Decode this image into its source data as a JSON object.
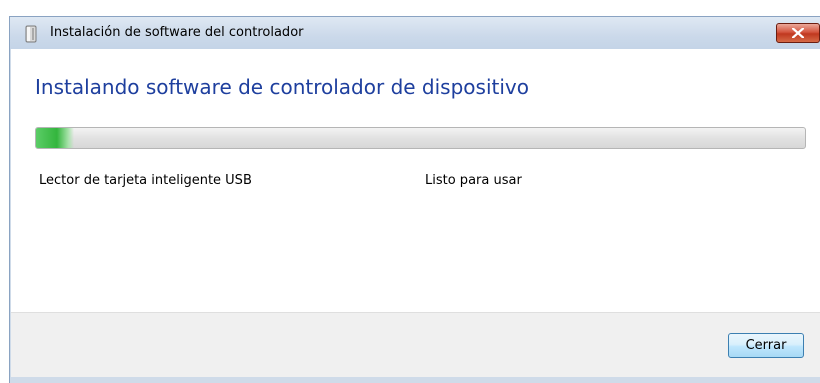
{
  "window": {
    "title": "Instalación de software del controlador"
  },
  "icons": {
    "title_icon": "driver-installer-icon",
    "close_icon": "close-x-icon"
  },
  "colors": {
    "heading": "#1e3f9e",
    "progress_fill": "#33b53d",
    "close_button": "#c0381f"
  },
  "heading": "Instalando software de controlador de dispositivo",
  "progress": {
    "percent": 5
  },
  "device": {
    "name": "Lector de tarjeta inteligente USB",
    "status": "Listo para usar"
  },
  "footer": {
    "close_label": "Cerrar"
  }
}
